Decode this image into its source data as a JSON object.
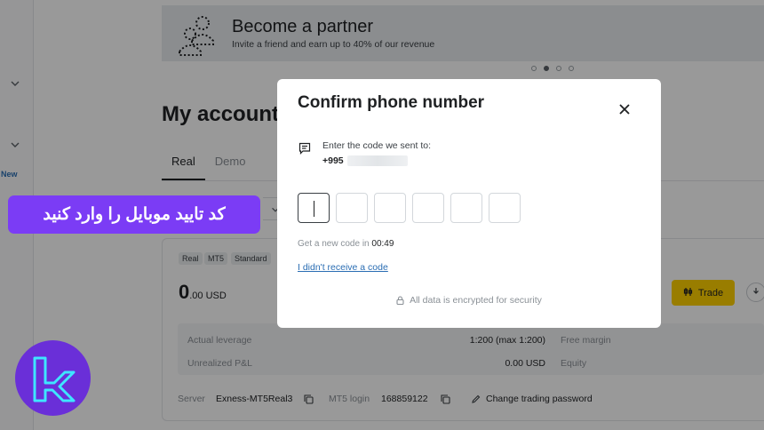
{
  "sidebar": {
    "new_badge": "New"
  },
  "banner": {
    "title": "Become a partner",
    "subtitle": "Invite a friend and earn up to 40% of our revenue",
    "slides": 4,
    "active_slide": 2
  },
  "accounts": {
    "title": "My accounts",
    "tabs": [
      "Real",
      "Demo"
    ],
    "active_tab": "Real"
  },
  "account_card": {
    "tags": [
      "Real",
      "MT5",
      "Standard"
    ],
    "balance_int": "0",
    "balance_dec": ".00 USD",
    "trade_label": "Trade",
    "stats": {
      "leverage_label": "Actual leverage",
      "leverage_value": "1:200 (max 1:200)",
      "free_margin_label": "Free margin",
      "pnl_label": "Unrealized P&L",
      "pnl_value": "0.00 USD",
      "equity_label": "Equity"
    },
    "server_label": "Server",
    "server_value": "Exness-MT5Real3",
    "login_label": "MT5 login",
    "login_value": "168859122",
    "change_password": "Change trading password"
  },
  "modal": {
    "title": "Confirm phone number",
    "sent_to_text": "Enter the code we sent to:",
    "phone_prefix": "+995",
    "resend_text": "Get a new code in ",
    "timer": "00:49",
    "no_code_link": "I didn't receive a code",
    "security_note": "All data is encrypted for security"
  },
  "caption": {
    "text": "کد تایید موبایل را وارد کنید"
  },
  "colors": {
    "accent_purple": "#7b3cf5",
    "trade_yellow": "#ffd100",
    "link_blue": "#2a6db3",
    "logo_cyan": "#3ee6ff"
  }
}
